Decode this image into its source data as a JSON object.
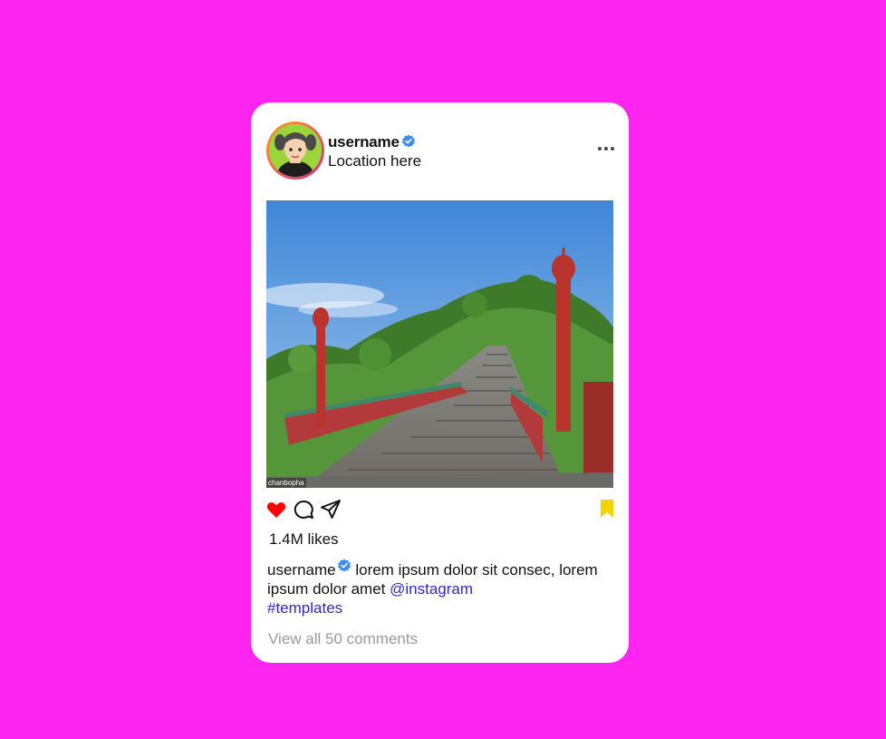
{
  "post": {
    "username": "username",
    "location": "Location here",
    "photo_credit": "chanbopha",
    "likes": "1.4M likes",
    "caption": {
      "username": "username",
      "text": " lorem ipsum dolor sit consec, lorem ipsum dolor amet ",
      "mention": "@instagram",
      "hashtag": "#templates"
    },
    "view_comments": "View all 50 comments"
  },
  "icons": {
    "verified": "verified-badge-icon",
    "more": "more-horizontal-icon",
    "like": "heart-icon",
    "comment": "comment-icon",
    "share": "send-icon",
    "save": "bookmark-icon"
  },
  "colors": {
    "background": "#ff25f0",
    "card": "#ffffff",
    "heart": "#ff0000",
    "bookmark": "#f3d400",
    "verified": "#3a8ef0",
    "link": "#2f28c9",
    "muted": "#9a9a9a"
  }
}
